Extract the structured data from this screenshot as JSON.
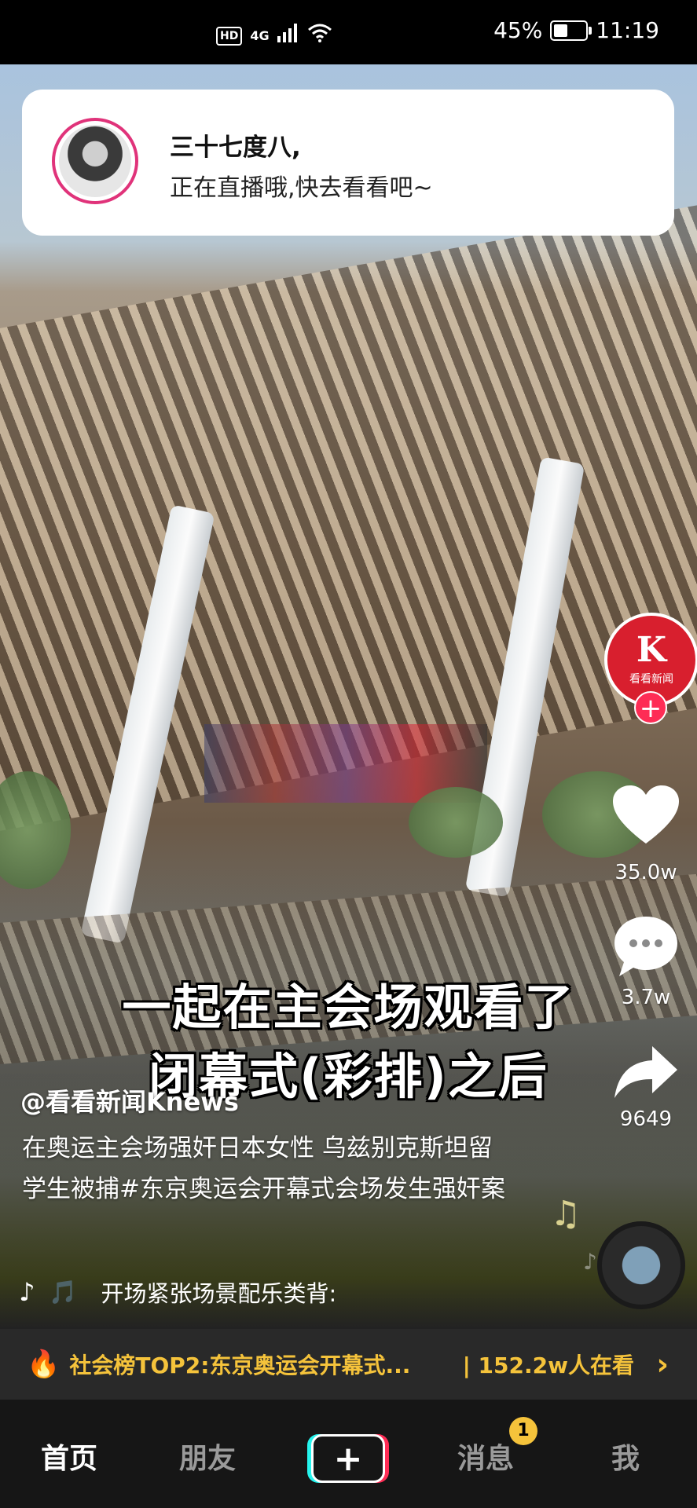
{
  "status_bar": {
    "network": "HD",
    "signal_type": "4G",
    "battery_percent": "45%",
    "battery_level": 0.45,
    "time": "11:19"
  },
  "notification": {
    "title": "三十七度八,",
    "body": "正在直播哦,快去看看吧~"
  },
  "creator": {
    "logo_text": "K",
    "name_text": "看看新闻",
    "follow_label": "+"
  },
  "actions": {
    "likes": "35.0w",
    "comments": "3.7w",
    "shares": "9649"
  },
  "video": {
    "caption_line1": "一起在主会场观看了",
    "caption_line2": "闭幕式(彩排)之后",
    "author": "@看看新闻Knews",
    "description": "在奥运主会场强奸日本女性 乌兹别克斯坦留学生被捕#东京奥运会开幕式会场发生强奸案",
    "music": "开场紧张场景配乐类背:",
    "music_prefix": "🎵"
  },
  "hot_banner": {
    "text": "社会榜TOP2:东京奥运会开幕式...",
    "viewers": "| 152.2w人在看"
  },
  "tab_bar": {
    "home": "首页",
    "friends": "朋友",
    "create": "+",
    "messages": "消息",
    "messages_badge": "1",
    "me": "我"
  },
  "icons": {
    "like": "heart-icon",
    "comment": "comment-icon",
    "share": "share-icon",
    "music": "music-note-icon",
    "hot": "flame-icon"
  }
}
